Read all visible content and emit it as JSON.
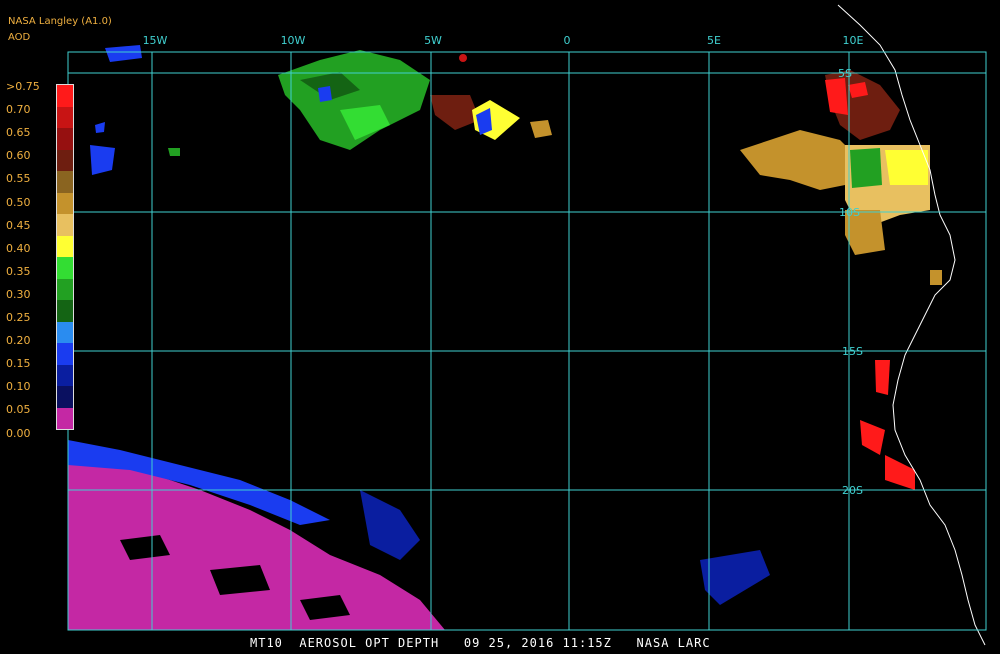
{
  "header": {
    "title": "NASA Langley (A1.0)",
    "subtitle": "AOD"
  },
  "colors": {
    "grid": "#40d0d0",
    "coast": "#ffffff",
    "label_text": "#f0b040"
  },
  "legend": {
    "items": [
      {
        "label": ">0.75",
        "color": "#ff1a1a"
      },
      {
        "label": "0.70",
        "color": "#c81414"
      },
      {
        "label": "0.65",
        "color": "#961010"
      },
      {
        "label": "0.60",
        "color": "#6e1e10"
      },
      {
        "label": "0.55",
        "color": "#8a6420"
      },
      {
        "label": "0.50",
        "color": "#c4922c"
      },
      {
        "label": "0.45",
        "color": "#e8c060"
      },
      {
        "label": "0.40",
        "color": "#ffff33"
      },
      {
        "label": "0.35",
        "color": "#33dd33"
      },
      {
        "label": "0.30",
        "color": "#22a022"
      },
      {
        "label": "0.25",
        "color": "#146414"
      },
      {
        "label": "0.20",
        "color": "#2a8cf0"
      },
      {
        "label": "0.15",
        "color": "#1a3cf0"
      },
      {
        "label": "0.10",
        "color": "#0a1ea0"
      },
      {
        "label": "0.05",
        "color": "#0a1060"
      },
      {
        "label": "0.00",
        "color": "#c428a4"
      }
    ]
  },
  "axes": {
    "longitudes": [
      "15W",
      "10W",
      "5W",
      "0",
      "5E",
      "10E"
    ],
    "latitudes": [
      "5S",
      "10S",
      "15S",
      "20S"
    ]
  },
  "footer": {
    "text": "MT10  AEROSOL OPT DEPTH   09 25, 2016 11:15Z   NASA LARC"
  }
}
